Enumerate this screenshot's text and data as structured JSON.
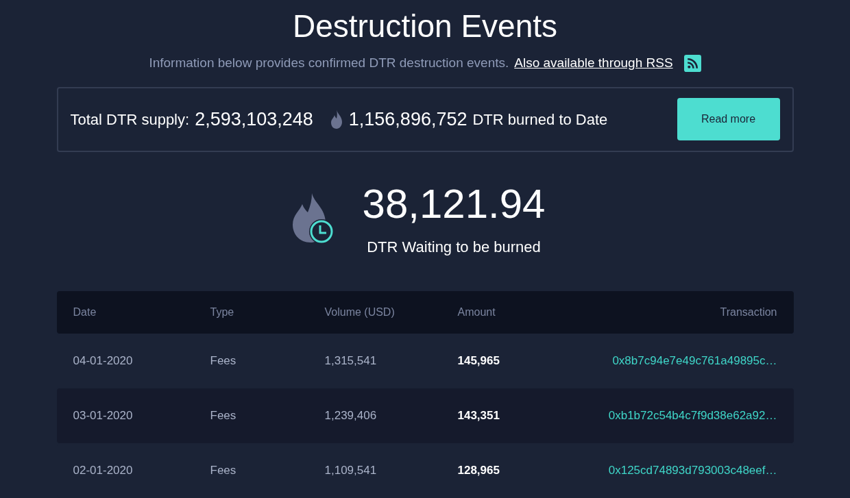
{
  "title": "Destruction Events",
  "subtitle": {
    "text": "Information below provides confirmed DTR destruction events.",
    "link": "Also available through RSS"
  },
  "summary": {
    "supply_label": "Total DTR supply:",
    "supply_value": "2,593,103,248",
    "burned_value": "1,156,896,752",
    "burned_label": "DTR burned to Date",
    "button": "Read more"
  },
  "waiting": {
    "value": "38,121.94",
    "label": "DTR Waiting to be burned"
  },
  "table": {
    "columns": [
      "Date",
      "Type",
      "Volume (USD)",
      "Amount",
      "Transaction"
    ],
    "rows": [
      {
        "date": "04-01-2020",
        "type": "Fees",
        "volume": "1,315,541",
        "amount": "145,965",
        "transaction": "0x8b7c94e7e49c761a49895c…"
      },
      {
        "date": "03-01-2020",
        "type": "Fees",
        "volume": "1,239,406",
        "amount": "143,351",
        "transaction": "0xb1b72c54b4c7f9d38e62a92…"
      },
      {
        "date": "02-01-2020",
        "type": "Fees",
        "volume": "1,109,541",
        "amount": "128,965",
        "transaction": "0x125cd74893d793003c48eef…"
      }
    ]
  }
}
